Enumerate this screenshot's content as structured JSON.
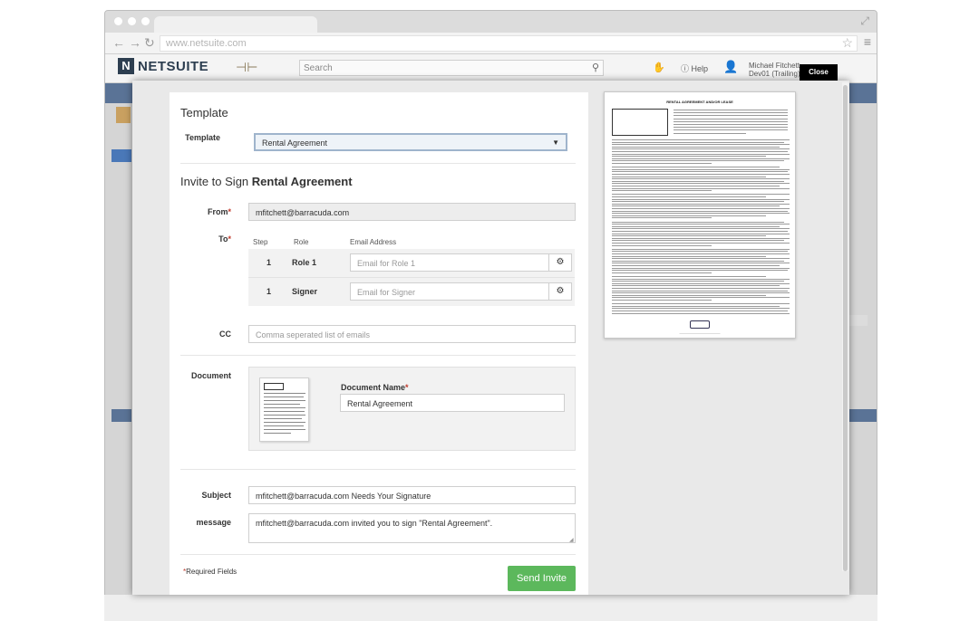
{
  "browser": {
    "url": "www.netsuite.com"
  },
  "app": {
    "logo_text": "NETSUITE",
    "search_placeholder": "Search",
    "help_label": "Help",
    "user_name": "Michael Fitchett",
    "user_role": "Dev01 (Trailing) -"
  },
  "modal": {
    "close_label": "Close",
    "template": {
      "title": "Template",
      "label": "Template",
      "selected": "Rental Agreement"
    },
    "invite": {
      "title_prefix": "Invite to Sign ",
      "title_doc": "Rental Agreement",
      "from_label": "From",
      "from_value": "mfitchett@barracuda.com",
      "to_label": "To",
      "columns": [
        "Step",
        "Role",
        "Email Address"
      ],
      "recipients": [
        {
          "step": "1",
          "role": "Role 1",
          "placeholder": "Email for Role 1"
        },
        {
          "step": "1",
          "role": "Signer",
          "placeholder": "Email for Signer"
        }
      ],
      "cc_label": "CC",
      "cc_placeholder": "Comma seperated list of emails",
      "document_label": "Document",
      "document_name_label": "Document Name",
      "document_name_value": "Rental Agreement",
      "subject_label": "Subject",
      "subject_value": "mfitchett@barracuda.com Needs Your Signature",
      "message_label": "message",
      "message_value": "mfitchett@barracuda.com invited you to sign \"Rental Agreement\".",
      "required_note": "Required Fields",
      "send_label": "Send Invite"
    },
    "preview": {
      "title": "RENTAL AGREEMENT AND/OR LEASE"
    }
  }
}
